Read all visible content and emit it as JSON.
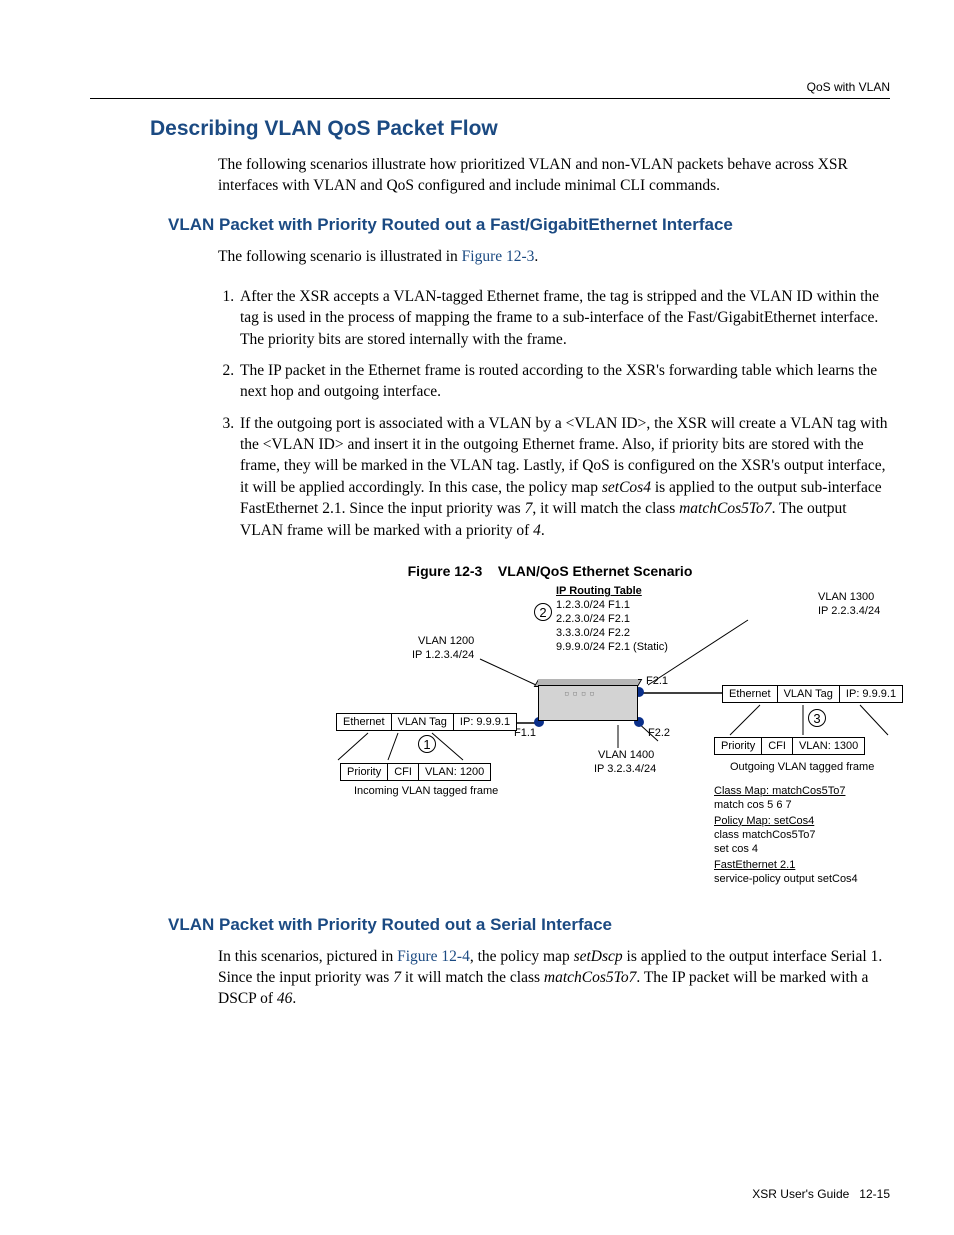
{
  "header": {
    "right": "QoS with VLAN"
  },
  "h1": "Describing VLAN QoS Packet Flow",
  "intro": "The following scenarios illustrate how prioritized VLAN and non-VLAN packets behave across XSR interfaces with VLAN and QoS configured and include minimal CLI commands.",
  "section1": {
    "title": "VLAN Packet with Priority Routed out a Fast/GigabitEthernet Interface",
    "lead_pre": "The following scenario is illustrated in ",
    "lead_link": "Figure 12-3",
    "lead_post": ".",
    "items": [
      "After the XSR accepts a VLAN-tagged Ethernet frame, the tag is stripped and the VLAN ID within the tag is used in the process of mapping the frame to a sub-interface of the Fast/GigabitEthernet interface. The priority bits are stored internally with the frame.",
      "The IP packet in the Ethernet frame is routed according to the XSR's forwarding table which learns the next hop and outgoing interface."
    ],
    "item3_a": "If the outgoing port is associated with a VLAN by a <VLAN ID>, the XSR will create a VLAN tag with the <VLAN ID> and insert it in the outgoing Ethernet frame. Also, if priority bits are stored with the frame, they will be marked in the VLAN tag. Lastly, if QoS is configured on the XSR's output interface, it will be applied accordingly. In this case, the policy map ",
    "item3_i1": "setCos4",
    "item3_b": " is applied to the output sub-interface FastEthernet 2.1. Since the input priority was ",
    "item3_i2": "7",
    "item3_c": ", it will match the class ",
    "item3_i3": "matchCos5To7",
    "item3_d": ". The output VLAN frame will be marked with a priority of ",
    "item3_i4": "4",
    "item3_e": "."
  },
  "figure": {
    "caption_a": "Figure 12-3",
    "caption_b": "VLAN/QoS Ethernet Scenario",
    "routing_head": "IP Routing Table",
    "routes": [
      "1.2.3.0/24 F1.1",
      "2.2.3.0/24 F2.1",
      "3.3.3.0/24 F2.2",
      "9.9.9.0/24 F2.1 (Static)"
    ],
    "left_vlan": "VLAN 1200",
    "left_ip": "IP 1.2.3.4/24",
    "right_vlan": "VLAN 1300",
    "right_ip": "IP 2.2.3.4/24",
    "bot_vlan": "VLAN 1400",
    "bot_ip": "IP 3.2.3.4/24",
    "f11": "F1.1",
    "f21": "F2.1",
    "f22": "F2.2",
    "eth": "Ethernet",
    "vtag": "VLAN Tag",
    "ip1": "IP: 9.9.9.1",
    "ip2": "IP: 9.9.9.1",
    "pri": "Priority",
    "cfi": "CFI",
    "vl1200": "VLAN: 1200",
    "vl1300": "VLAN: 1300",
    "incoming": "Incoming VLAN tagged frame",
    "outgoing": "Outgoing VLAN tagged frame",
    "cmap_h": "Class Map: matchCos5To7",
    "cmap_l": "match cos 5 6 7",
    "pmap_h": "Policy Map: setCos4",
    "pmap_l1": "class matchCos5To7",
    "pmap_l2": "set cos 4",
    "fe_h": "FastEthernet 2.1",
    "fe_l": "service-policy output setCos4"
  },
  "section2": {
    "title": "VLAN Packet with Priority Routed out a Serial Interface",
    "p_a": "In this scenarios, pictured in ",
    "p_link": "Figure 12-4",
    "p_b": ", the policy map ",
    "p_i1": "setDscp",
    "p_c": " is applied to the output interface Serial 1. Since the input priority was ",
    "p_i2": "7",
    "p_d": " it will match the class ",
    "p_i3": "matchCos5To7",
    "p_e": ". The IP packet will be marked with a DSCP of ",
    "p_i4": "46",
    "p_f": "."
  },
  "footer": {
    "book": "XSR User's Guide",
    "page": "12-15"
  }
}
